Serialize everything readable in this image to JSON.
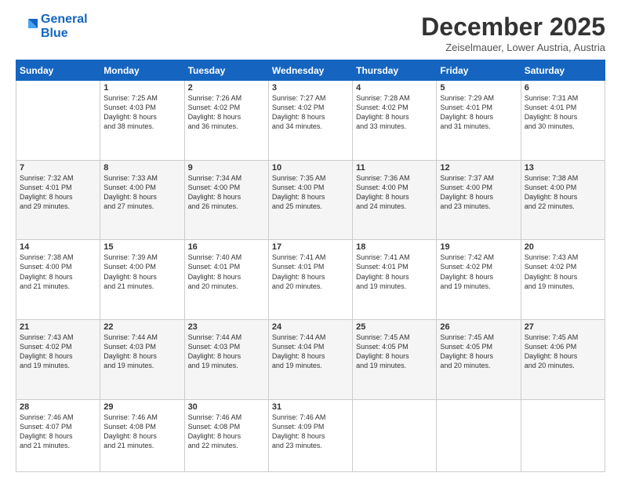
{
  "logo": {
    "line1": "General",
    "line2": "Blue"
  },
  "header": {
    "title": "December 2025",
    "location": "Zeiselmauer, Lower Austria, Austria"
  },
  "days_of_week": [
    "Sunday",
    "Monday",
    "Tuesday",
    "Wednesday",
    "Thursday",
    "Friday",
    "Saturday"
  ],
  "weeks": [
    [
      {
        "day": "",
        "info": ""
      },
      {
        "day": "1",
        "info": "Sunrise: 7:25 AM\nSunset: 4:03 PM\nDaylight: 8 hours\nand 38 minutes."
      },
      {
        "day": "2",
        "info": "Sunrise: 7:26 AM\nSunset: 4:02 PM\nDaylight: 8 hours\nand 36 minutes."
      },
      {
        "day": "3",
        "info": "Sunrise: 7:27 AM\nSunset: 4:02 PM\nDaylight: 8 hours\nand 34 minutes."
      },
      {
        "day": "4",
        "info": "Sunrise: 7:28 AM\nSunset: 4:02 PM\nDaylight: 8 hours\nand 33 minutes."
      },
      {
        "day": "5",
        "info": "Sunrise: 7:29 AM\nSunset: 4:01 PM\nDaylight: 8 hours\nand 31 minutes."
      },
      {
        "day": "6",
        "info": "Sunrise: 7:31 AM\nSunset: 4:01 PM\nDaylight: 8 hours\nand 30 minutes."
      }
    ],
    [
      {
        "day": "7",
        "info": "Sunrise: 7:32 AM\nSunset: 4:01 PM\nDaylight: 8 hours\nand 29 minutes."
      },
      {
        "day": "8",
        "info": "Sunrise: 7:33 AM\nSunset: 4:00 PM\nDaylight: 8 hours\nand 27 minutes."
      },
      {
        "day": "9",
        "info": "Sunrise: 7:34 AM\nSunset: 4:00 PM\nDaylight: 8 hours\nand 26 minutes."
      },
      {
        "day": "10",
        "info": "Sunrise: 7:35 AM\nSunset: 4:00 PM\nDaylight: 8 hours\nand 25 minutes."
      },
      {
        "day": "11",
        "info": "Sunrise: 7:36 AM\nSunset: 4:00 PM\nDaylight: 8 hours\nand 24 minutes."
      },
      {
        "day": "12",
        "info": "Sunrise: 7:37 AM\nSunset: 4:00 PM\nDaylight: 8 hours\nand 23 minutes."
      },
      {
        "day": "13",
        "info": "Sunrise: 7:38 AM\nSunset: 4:00 PM\nDaylight: 8 hours\nand 22 minutes."
      }
    ],
    [
      {
        "day": "14",
        "info": "Sunrise: 7:38 AM\nSunset: 4:00 PM\nDaylight: 8 hours\nand 21 minutes."
      },
      {
        "day": "15",
        "info": "Sunrise: 7:39 AM\nSunset: 4:00 PM\nDaylight: 8 hours\nand 21 minutes."
      },
      {
        "day": "16",
        "info": "Sunrise: 7:40 AM\nSunset: 4:01 PM\nDaylight: 8 hours\nand 20 minutes."
      },
      {
        "day": "17",
        "info": "Sunrise: 7:41 AM\nSunset: 4:01 PM\nDaylight: 8 hours\nand 20 minutes."
      },
      {
        "day": "18",
        "info": "Sunrise: 7:41 AM\nSunset: 4:01 PM\nDaylight: 8 hours\nand 19 minutes."
      },
      {
        "day": "19",
        "info": "Sunrise: 7:42 AM\nSunset: 4:02 PM\nDaylight: 8 hours\nand 19 minutes."
      },
      {
        "day": "20",
        "info": "Sunrise: 7:43 AM\nSunset: 4:02 PM\nDaylight: 8 hours\nand 19 minutes."
      }
    ],
    [
      {
        "day": "21",
        "info": "Sunrise: 7:43 AM\nSunset: 4:02 PM\nDaylight: 8 hours\nand 19 minutes."
      },
      {
        "day": "22",
        "info": "Sunrise: 7:44 AM\nSunset: 4:03 PM\nDaylight: 8 hours\nand 19 minutes."
      },
      {
        "day": "23",
        "info": "Sunrise: 7:44 AM\nSunset: 4:03 PM\nDaylight: 8 hours\nand 19 minutes."
      },
      {
        "day": "24",
        "info": "Sunrise: 7:44 AM\nSunset: 4:04 PM\nDaylight: 8 hours\nand 19 minutes."
      },
      {
        "day": "25",
        "info": "Sunrise: 7:45 AM\nSunset: 4:05 PM\nDaylight: 8 hours\nand 19 minutes."
      },
      {
        "day": "26",
        "info": "Sunrise: 7:45 AM\nSunset: 4:05 PM\nDaylight: 8 hours\nand 20 minutes."
      },
      {
        "day": "27",
        "info": "Sunrise: 7:45 AM\nSunset: 4:06 PM\nDaylight: 8 hours\nand 20 minutes."
      }
    ],
    [
      {
        "day": "28",
        "info": "Sunrise: 7:46 AM\nSunset: 4:07 PM\nDaylight: 8 hours\nand 21 minutes."
      },
      {
        "day": "29",
        "info": "Sunrise: 7:46 AM\nSunset: 4:08 PM\nDaylight: 8 hours\nand 21 minutes."
      },
      {
        "day": "30",
        "info": "Sunrise: 7:46 AM\nSunset: 4:08 PM\nDaylight: 8 hours\nand 22 minutes."
      },
      {
        "day": "31",
        "info": "Sunrise: 7:46 AM\nSunset: 4:09 PM\nDaylight: 8 hours\nand 23 minutes."
      },
      {
        "day": "",
        "info": ""
      },
      {
        "day": "",
        "info": ""
      },
      {
        "day": "",
        "info": ""
      }
    ]
  ]
}
